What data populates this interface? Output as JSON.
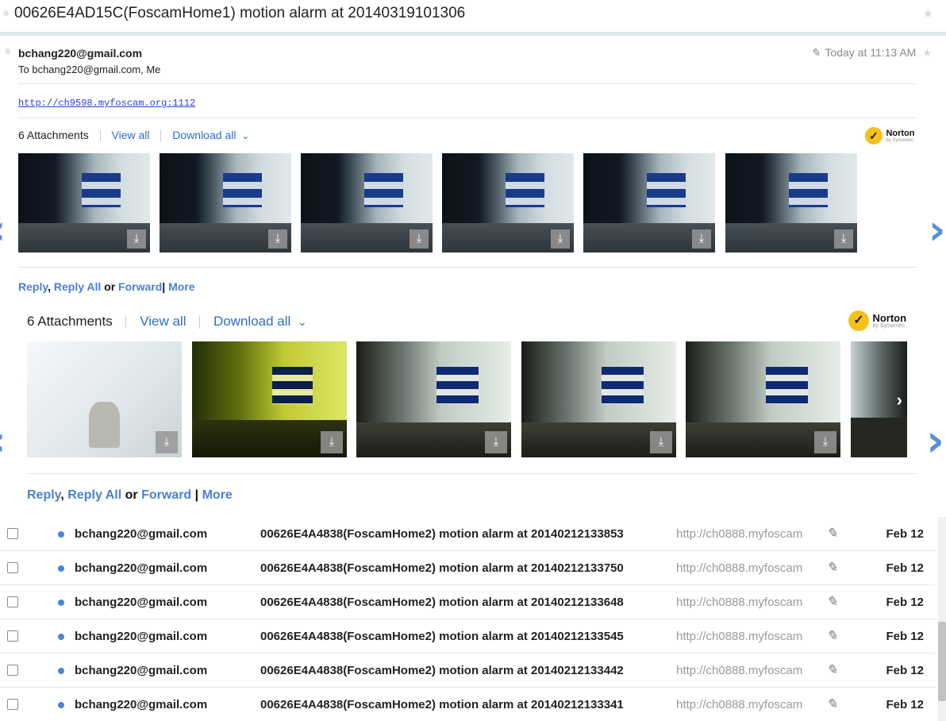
{
  "subject": {
    "title": "00626E4AD15C(FoscamHome1) motion alarm at 20140319101306",
    "star": "★"
  },
  "message": {
    "sender": "bchang220@gmail.com",
    "to": "To bchang220@gmail.com, Me",
    "date": "Today at 11:13 AM",
    "clip_icon": "✎",
    "star": "★",
    "link": "http://ch9598.myfoscam.org:1112"
  },
  "attachments_top": {
    "count": "6 Attachments",
    "view_all": "View all",
    "download_all": "Download all",
    "chevron": "⌄"
  },
  "attachments_bottom": {
    "count": "6 Attachments",
    "view_all": "View all",
    "download_all": "Download all",
    "chevron": "⌄"
  },
  "norton": {
    "name": "Norton",
    "sub": "by Symantec",
    "check": "✓"
  },
  "download_icon": "⤓",
  "arrows": {
    "left": "‹",
    "right": "›"
  },
  "reply": {
    "reply": "Reply",
    "comma": ",",
    "reply_all": "Reply All",
    "or": "or",
    "forward": "Forward",
    "pipe": "|",
    "more": "More"
  },
  "mail_list": [
    {
      "from": "bchang220@gmail.com",
      "subject": "00626E4A4838(FoscamHome2) motion alarm at 20140212133853",
      "snippet": "http://ch0888.myfoscam",
      "date": "Feb 12"
    },
    {
      "from": "bchang220@gmail.com",
      "subject": "00626E4A4838(FoscamHome2) motion alarm at 20140212133750",
      "snippet": "http://ch0888.myfoscam",
      "date": "Feb 12"
    },
    {
      "from": "bchang220@gmail.com",
      "subject": "00626E4A4838(FoscamHome2) motion alarm at 20140212133648",
      "snippet": "http://ch0888.myfoscam",
      "date": "Feb 12"
    },
    {
      "from": "bchang220@gmail.com",
      "subject": "00626E4A4838(FoscamHome2) motion alarm at 20140212133545",
      "snippet": "http://ch0888.myfoscam",
      "date": "Feb 12"
    },
    {
      "from": "bchang220@gmail.com",
      "subject": "00626E4A4838(FoscamHome2) motion alarm at 20140212133442",
      "snippet": "http://ch0888.myfoscam",
      "date": "Feb 12"
    },
    {
      "from": "bchang220@gmail.com",
      "subject": "00626E4A4838(FoscamHome2) motion alarm at 20140212133341",
      "snippet": "http://ch0888.myfoscam",
      "date": "Feb 12"
    }
  ],
  "row_clip_icon": "✎"
}
